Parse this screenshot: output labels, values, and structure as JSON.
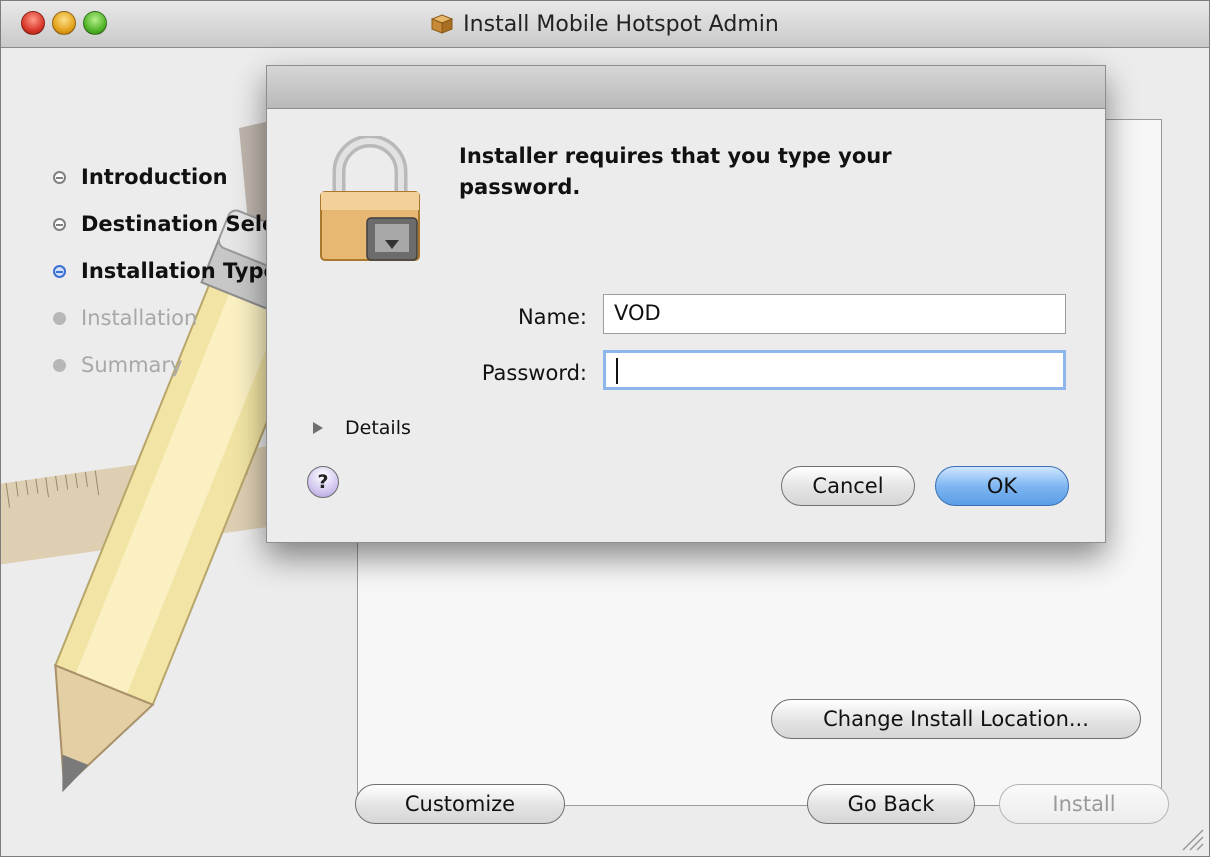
{
  "window": {
    "title": "Install Mobile Hotspot Admin"
  },
  "sidebar": {
    "steps": [
      {
        "label": "Introduction",
        "state": "done"
      },
      {
        "label": "Destination Select",
        "state": "done"
      },
      {
        "label": "Installation Type",
        "state": "current"
      },
      {
        "label": "Installation",
        "state": "future"
      },
      {
        "label": "Summary",
        "state": "future"
      }
    ]
  },
  "panel": {
    "change_location_label": "Change Install Location..."
  },
  "footer": {
    "customize_label": "Customize",
    "go_back_label": "Go Back",
    "install_label": "Install"
  },
  "auth_dialog": {
    "prompt": "Installer requires that you type your password.",
    "name_label": "Name:",
    "name_value": "VOD",
    "password_label": "Password:",
    "password_value": "",
    "details_label": "Details",
    "help_label": "?",
    "cancel_label": "Cancel",
    "ok_label": "OK"
  }
}
